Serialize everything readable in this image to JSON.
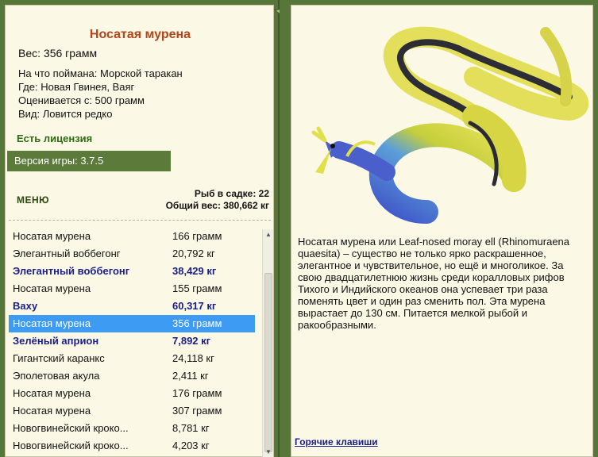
{
  "fish": {
    "title": "Носатая мурена",
    "weight": "Вес: 356 грамм",
    "caught_on": "На что поймана: Морской таракан",
    "location": "Где: Новая Гвинея, Ваяг",
    "price": "Оценивается с: 500 грамм",
    "rarity": "Вид: Ловится редко"
  },
  "license": "Есть лицензия",
  "version": "Версия игры: 3.7.5",
  "menu_label": "МЕНЮ",
  "stats": {
    "count": "Рыб в садке: 22",
    "total": "Общий вес: 380,662 кг"
  },
  "catch_list": [
    {
      "name": "Носатая мурена",
      "weight": "166 грамм",
      "bold": false,
      "selected": false
    },
    {
      "name": "Элегантный воббегонг",
      "weight": "20,792 кг",
      "bold": false,
      "selected": false
    },
    {
      "name": "Элегантный воббегонг",
      "weight": "38,429 кг",
      "bold": true,
      "selected": false
    },
    {
      "name": "Носатая мурена",
      "weight": "155 грамм",
      "bold": false,
      "selected": false
    },
    {
      "name": "Ваху",
      "weight": "60,317 кг",
      "bold": true,
      "selected": false
    },
    {
      "name": "Носатая мурена",
      "weight": "356 грамм",
      "bold": false,
      "selected": true
    },
    {
      "name": "Зелёный априон",
      "weight": "7,892 кг",
      "bold": true,
      "selected": false
    },
    {
      "name": "Гигантский каранкс",
      "weight": "24,118 кг",
      "bold": false,
      "selected": false
    },
    {
      "name": "Эполетовая акула",
      "weight": "2,411 кг",
      "bold": false,
      "selected": false
    },
    {
      "name": "Носатая мурена",
      "weight": "176 грамм",
      "bold": false,
      "selected": false
    },
    {
      "name": "Носатая мурена",
      "weight": "307 грамм",
      "bold": false,
      "selected": false
    },
    {
      "name": "Новогвинейский кроко...",
      "weight": "8,781 кг",
      "bold": false,
      "selected": false
    },
    {
      "name": "Новогвинейский кроко...",
      "weight": "4,203 кг",
      "bold": false,
      "selected": false
    }
  ],
  "description": "Носатая мурена или Leaf-nosed moray ell (Rhinomuraena quaesita) – существо не только ярко раскрашенное, элегантное и чувствительное, но ещё и многоликое. За свою двадцатилетнюю жизнь среди коралловых рифов Тихого и Индийского океанов она успевает три раза поменять цвет и один раз сменить пол. Эта мурена вырастает до 130 см. Питается мелкой рыбой и ракообразными.",
  "hotkeys_label": "Горячие клавиши",
  "colors": {
    "frame": "#57773a",
    "panel": "#fbf9e6",
    "title": "#b5441a",
    "license": "#2d6a12",
    "highlight": "#3d9bf3",
    "bold_row": "#1a1f86"
  }
}
